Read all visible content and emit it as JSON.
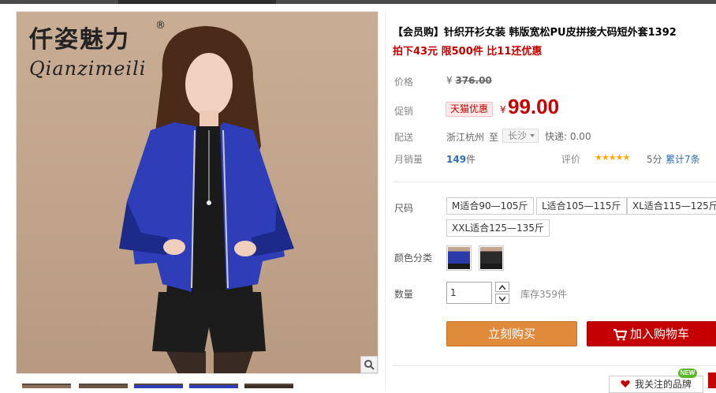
{
  "brand": {
    "logo_cn": "仟姿魅力",
    "logo_en": "Qianzimeili",
    "logo_reg": "®"
  },
  "product": {
    "title": "【会员购】针织开衫女装 韩版宽松PU皮拼接大码短外套1392",
    "promo_line": "拍下43元 限500件 比11还优惠"
  },
  "pricing": {
    "label_price": "价格",
    "currency": "¥",
    "original_price": "376.00",
    "label_promo": "促销",
    "promo_tag": "天猫优惠",
    "promo_price": "99.00"
  },
  "shipping": {
    "label": "配送",
    "origin": "浙江杭州",
    "to": "至",
    "destination": "长沙",
    "express": "快递: 0.00"
  },
  "stats": {
    "label_sales": "月销量",
    "sales_count": "149",
    "sales_unit": "件",
    "label_rating": "评价",
    "stars": "★★★★★",
    "rating_score": "5分",
    "review_count_text": "累计7条"
  },
  "sizes": {
    "label": "尺码",
    "options": [
      "M适合90—105斤",
      "L适合105—115斤",
      "XL适合115—125斤",
      "XXL适合125—135斤"
    ]
  },
  "colors": {
    "label": "颜色分类",
    "swatches": [
      {
        "name": "blue-jacket",
        "color": "#2a3aa8"
      },
      {
        "name": "black-jacket",
        "color": "#2a2a2a"
      }
    ]
  },
  "quantity": {
    "label": "数量",
    "value": "1",
    "stock": "库存359件"
  },
  "actions": {
    "buy_now": "立刻购买",
    "add_to_cart": "加入购物车",
    "favorite": "我关注的品牌",
    "new_badge": "NEW"
  },
  "colors_theme": {
    "price_red": "#c40000",
    "buy_orange": "#e08a3c",
    "link_blue": "#2a6db5"
  }
}
